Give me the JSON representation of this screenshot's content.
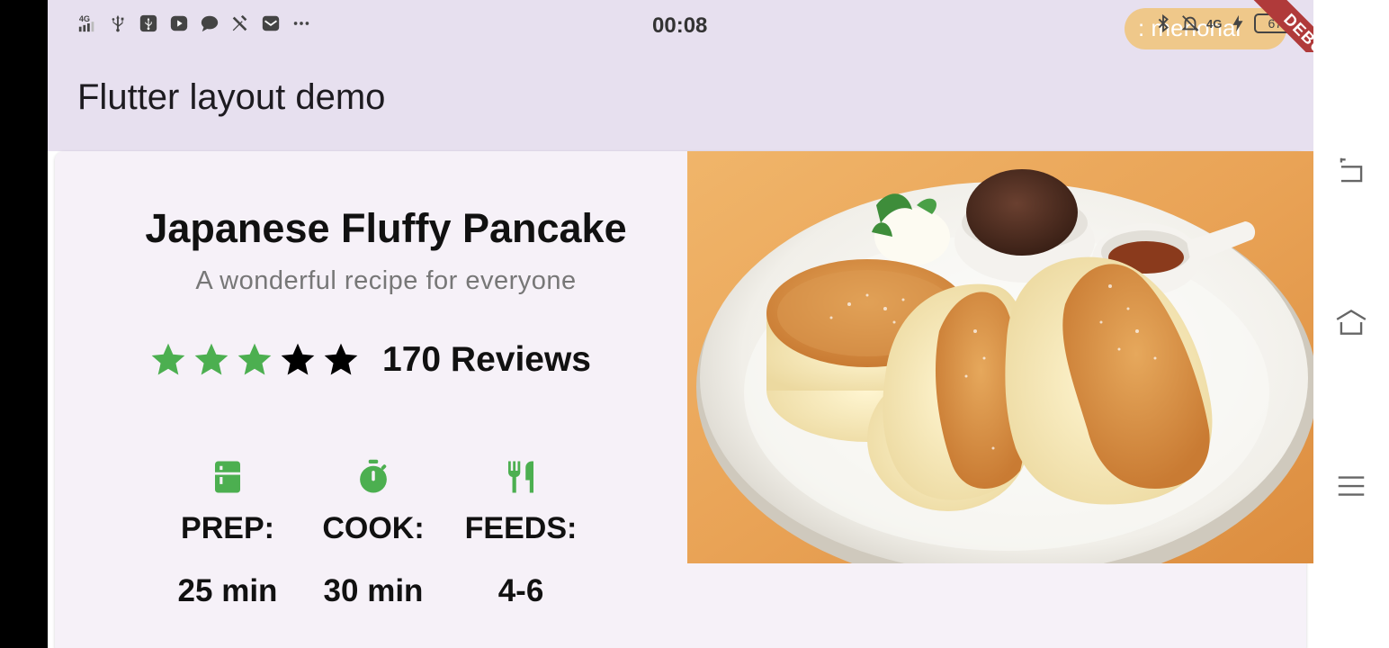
{
  "status_bar": {
    "time": "00:08",
    "pill_text": ": menonal",
    "network_label": "4G",
    "battery_level": "67",
    "left_icons": [
      "signal-4g-icon",
      "usb-icon",
      "usb-debug-icon",
      "youtube-icon",
      "chat-icon",
      "tools-icon",
      "mail-icon",
      "more-icon"
    ],
    "right_icons": [
      "bluetooth-icon",
      "mute-icon",
      "signal-icon",
      "charging-icon",
      "battery-icon"
    ]
  },
  "debug_banner": "DEBUG",
  "app_bar": {
    "title": "Flutter layout demo"
  },
  "recipe": {
    "title": "Japanese Fluffy Pancake",
    "subtitle": "A wonderful recipe for everyone",
    "rating": {
      "filled_stars": 3,
      "total_stars": 5,
      "filled_color": "#4caf50",
      "empty_color": "#000000",
      "reviews_label": "170 Reviews"
    },
    "info": [
      {
        "icon": "kitchen-icon",
        "label": "PREP:",
        "value": "25 min"
      },
      {
        "icon": "timer-icon",
        "label": "COOK:",
        "value": "30 min"
      },
      {
        "icon": "restaurant-icon",
        "label": "FEEDS:",
        "value": "4-6"
      }
    ],
    "accent_color": "#4caf50"
  },
  "photo": {
    "subject": "pancake-photo"
  },
  "nav_bar": {
    "buttons": [
      "back-icon",
      "home-icon",
      "menu-icon"
    ]
  }
}
